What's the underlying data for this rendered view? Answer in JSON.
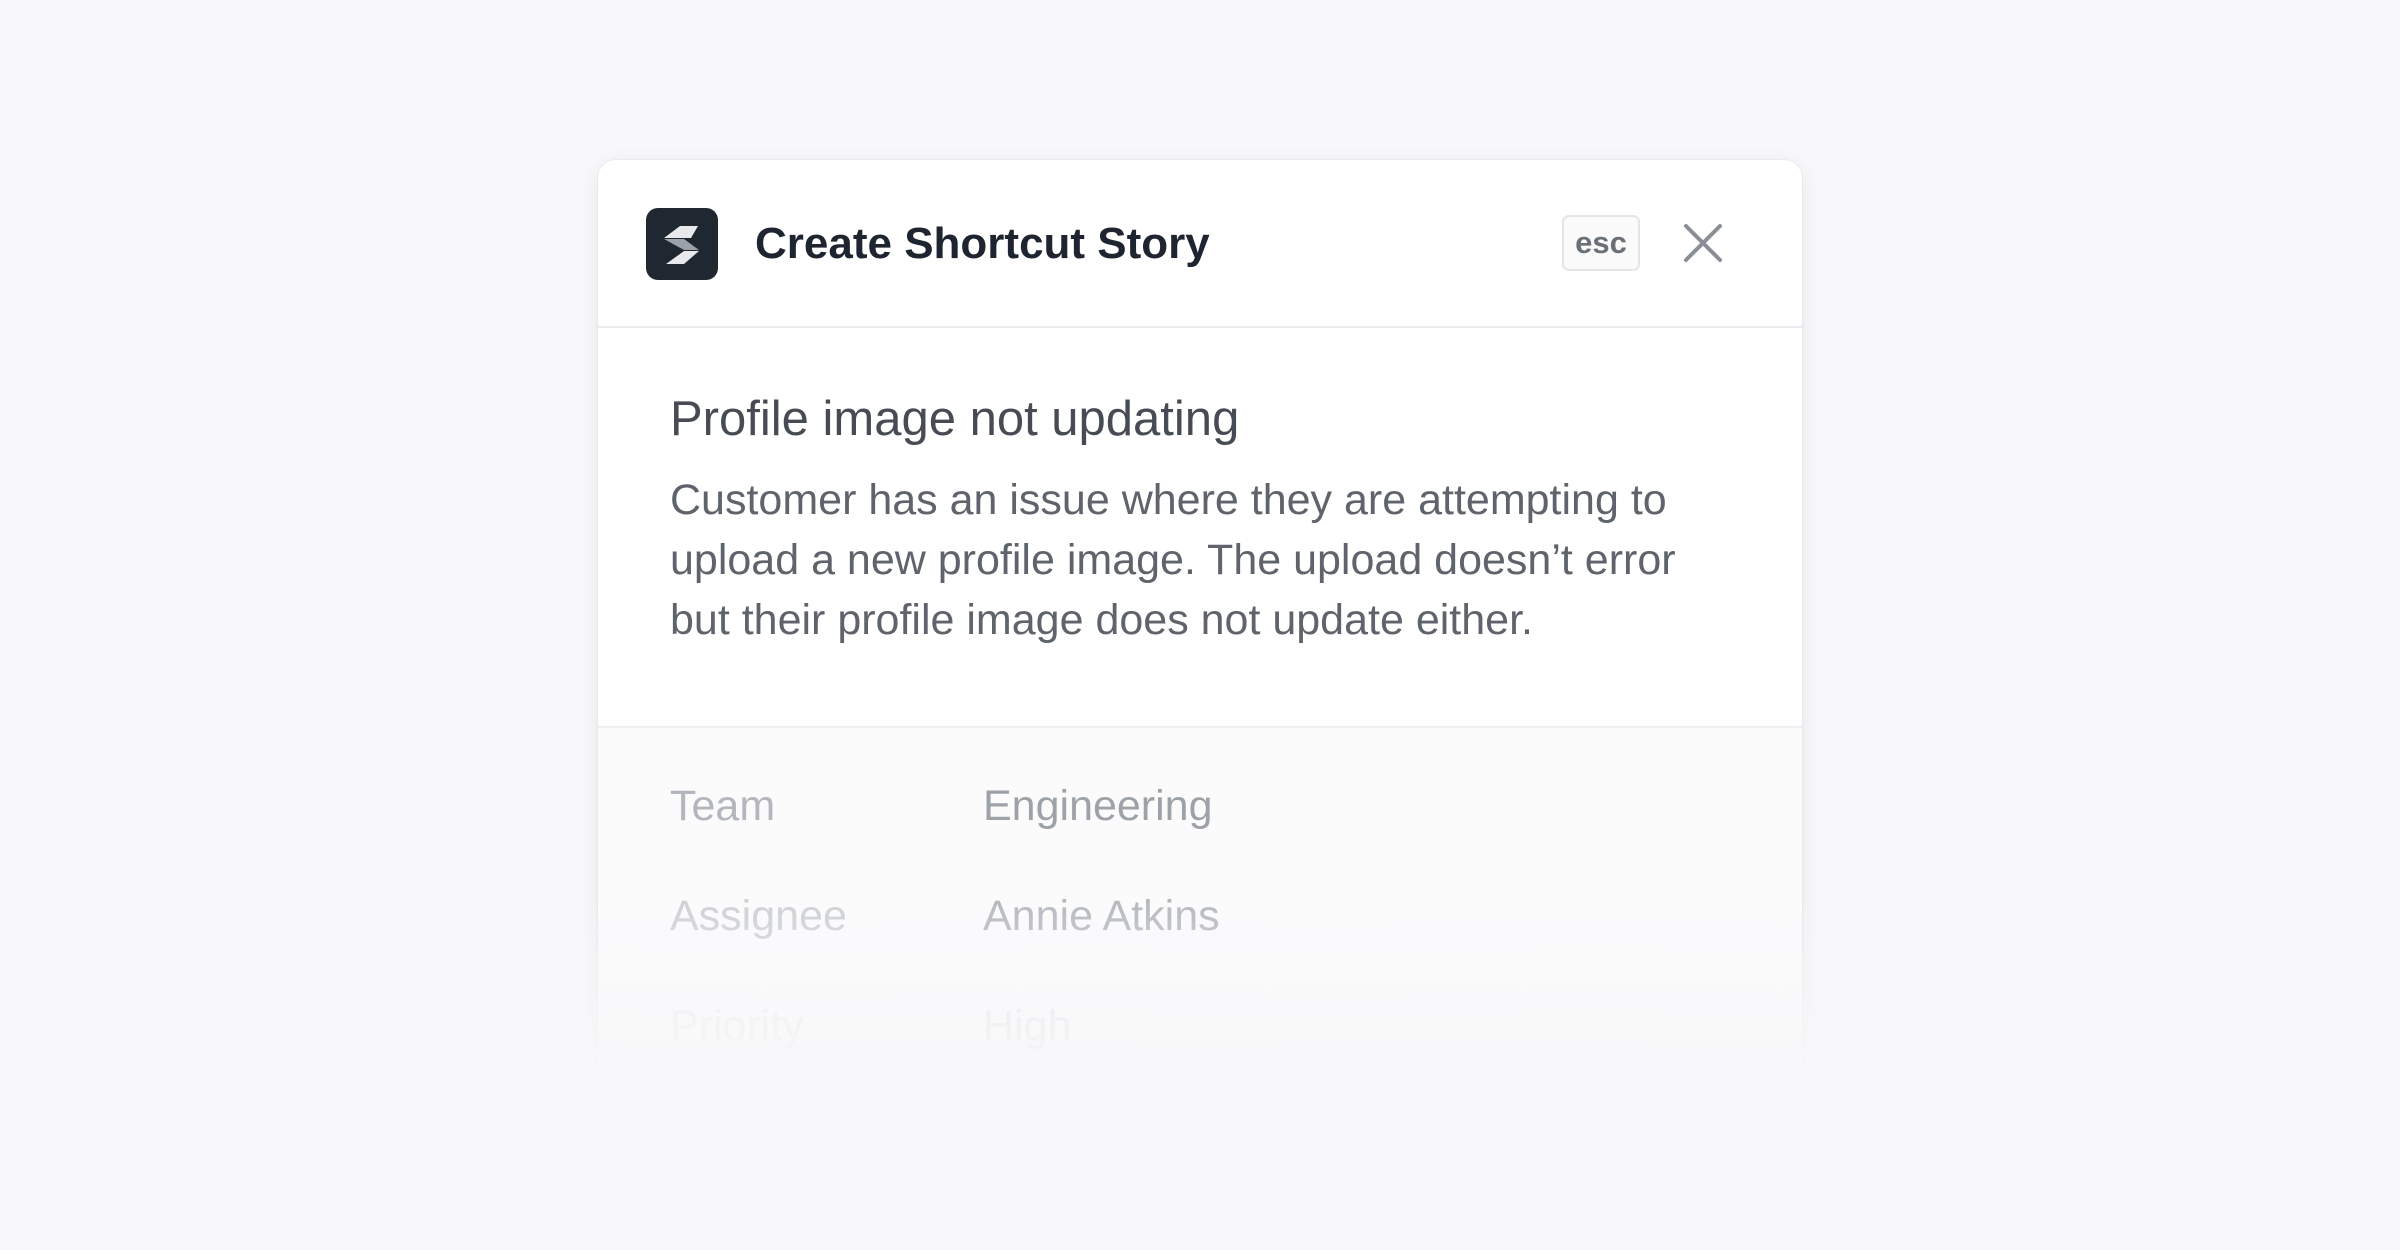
{
  "modal": {
    "title": "Create Shortcut Story",
    "app_icon": "shortcut-logo-icon",
    "esc_label": "esc",
    "close_icon": "close-icon"
  },
  "story": {
    "title": "Profile image not updating",
    "description": "Customer has an issue where they are attempting to upload a new profile image. The upload doesn’t error but their profile image does not update either."
  },
  "fields": [
    {
      "label": "Team",
      "value": "Engineering"
    },
    {
      "label": "Assignee",
      "value": "Annie Atkins"
    },
    {
      "label": "Priority",
      "value": "High"
    }
  ],
  "colors": {
    "background": "#f8f8fa",
    "icon_background": "#1f2730",
    "title_text": "#1e2530"
  }
}
